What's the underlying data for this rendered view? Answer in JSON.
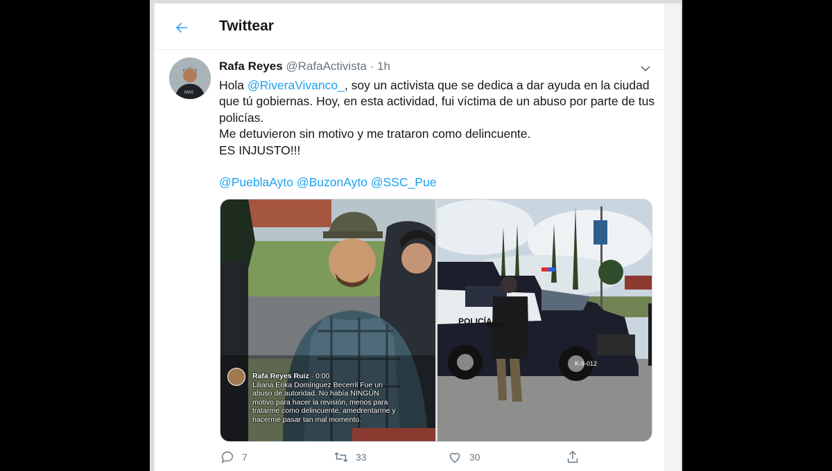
{
  "header": {
    "title": "Twittear"
  },
  "tweet": {
    "author_name": "Rafa Reyes",
    "handle": "@RafaActivista",
    "separator": "·",
    "time": "1h",
    "text": {
      "l1_a": "Hola ",
      "l1_mention": "@RiveraVivanco_",
      "l1_b": ", soy un activista que se dedica a dar ayuda en la ciudad que tú gobiernas. Hoy, en esta actividad, fui víctima de un abuso por parte de tus policías.",
      "l2": "Me detuvieron sin motivo y me trataron como delincuente.",
      "l3": "ES INJUSTO!!!",
      "mentions": [
        "@PueblaAyto",
        "@BuzonAyto",
        "@SSC_Pue"
      ]
    },
    "media": {
      "overlay_name": "Rafa Reyes Ruiz",
      "overlay_time": "0:00",
      "overlay_text": "Liliana Erika Domínguez Becerril Fue un abuso de autoridad. No había NINGÚN motivo para hacer la revisión, menos para tratarme como delincuente, amedrentarme y hacerme pasar tan mal momento.",
      "truck_label_1": "POLICÍA",
      "truck_label_2": "MUN",
      "truck_plate": "K-9-012"
    },
    "actions": {
      "replies": "7",
      "retweets": "33",
      "likes": "30"
    }
  },
  "colors": {
    "accent": "#1da1f2",
    "text": "#14171a",
    "muted": "#657786"
  }
}
